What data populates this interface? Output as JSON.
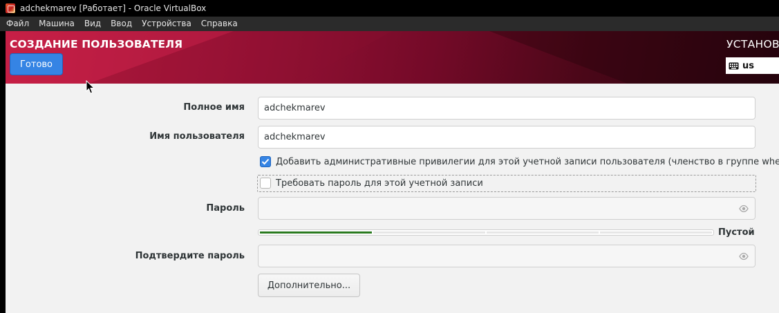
{
  "window": {
    "title": "adchekmarev [Работает] - Oracle VirtualBox",
    "menu": [
      "Файл",
      "Машина",
      "Вид",
      "Ввод",
      "Устройства",
      "Справка"
    ]
  },
  "header": {
    "page_title": "СОЗДАНИЕ ПОЛЬЗОВАТЕЛЯ",
    "done_label": "Готово",
    "install_title": "УСТАНОВК",
    "keyboard_layout": "us",
    "icons": {
      "keyboard": "keyboard-icon"
    }
  },
  "form": {
    "full_name": {
      "label": "Полное имя",
      "value": "adchekmarev"
    },
    "username": {
      "label": "Имя пользователя",
      "value": "adchekmarev"
    },
    "admin_checkbox": {
      "label": "Добавить административные привилегии для этой учетной записи пользователя (членство в группе wheel)",
      "checked": true
    },
    "require_password_checkbox": {
      "label": "Требовать пароль для этой учетной записи",
      "checked": false
    },
    "password": {
      "label": "Пароль",
      "value": "",
      "icon": "eye-icon"
    },
    "strength": {
      "label": "Пустой",
      "segments": 4,
      "filled": 1
    },
    "confirm_password": {
      "label": "Подтвердите пароль",
      "value": "",
      "icon": "eye-icon"
    },
    "advanced_label": "Дополнительно..."
  },
  "colors": {
    "accent": "#3584e4",
    "header_gradient_start": "#c01d41",
    "header_gradient_end": "#2a0410",
    "strength_fill": "#2a7a1f"
  }
}
